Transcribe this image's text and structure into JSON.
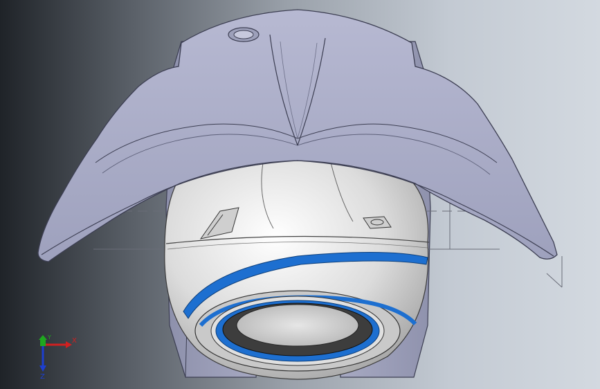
{
  "viewport": {
    "model": "camera-housing-3d-model",
    "colors": {
      "background_dark": "#1f2328",
      "background_light": "#d3d9e0",
      "shell": "#a9acc6",
      "shell_edge": "#3c3e52",
      "dome": "#e3e3e3",
      "accent_ring": "#1d6fd0"
    }
  },
  "triad": {
    "x_label": "X",
    "y_label": "Y",
    "z_label": "Z",
    "colors": {
      "x": "#d12020",
      "y": "#1fa81f",
      "z": "#1d3fd0"
    }
  }
}
